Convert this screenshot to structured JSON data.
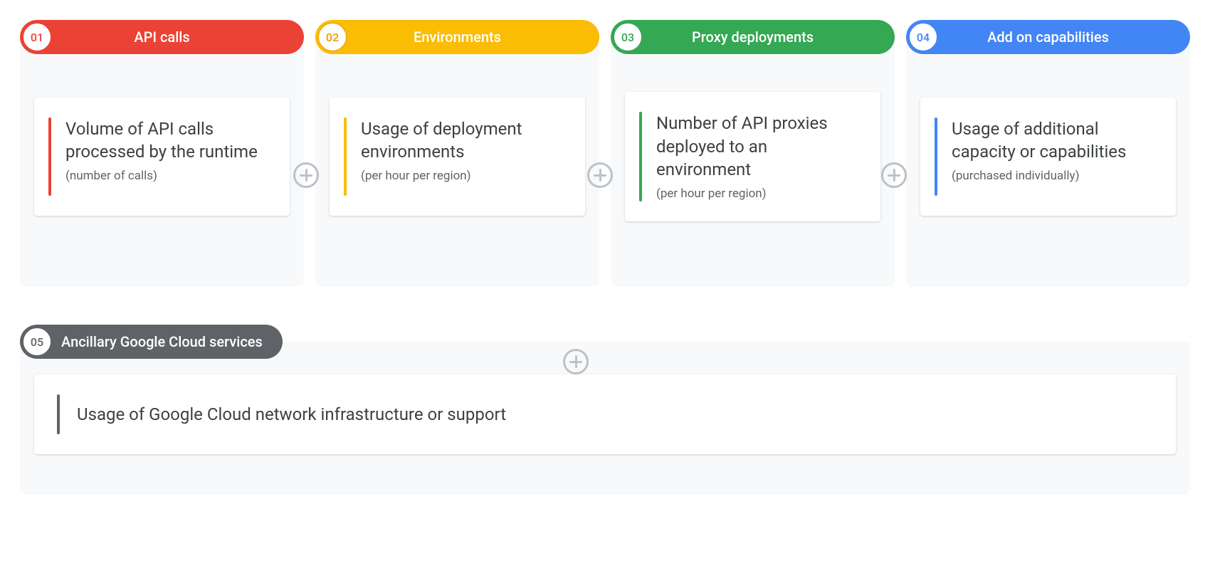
{
  "columns": [
    {
      "number": "01",
      "label": "API calls",
      "pillColor": "#ea4335",
      "numberColor": "#ea4335",
      "accentColor": "#ea4335",
      "title": "Volume of API calls processed by the runtime",
      "subtitle": "(number of calls)"
    },
    {
      "number": "02",
      "label": "Environments",
      "pillColor": "#fbbc04",
      "numberColor": "#f29900",
      "accentColor": "#fbbc04",
      "title": "Usage of deployment environments",
      "subtitle": "(per hour per region)"
    },
    {
      "number": "03",
      "label": "Proxy deployments",
      "pillColor": "#34a853",
      "numberColor": "#34a853",
      "accentColor": "#34a853",
      "title": "Number of API proxies deployed to an environment",
      "subtitle": "(per hour per region)"
    },
    {
      "number": "04",
      "label": "Add on capabilities",
      "pillColor": "#4285f4",
      "numberColor": "#4285f4",
      "accentColor": "#4285f4",
      "title": "Usage of additional capacity or capabilities",
      "subtitle": "(purchased individually)"
    }
  ],
  "bottom": {
    "number": "05",
    "label": "Ancillary Google Cloud services",
    "pillColor": "#5f6368",
    "numberColor": "#5f6368",
    "accentColor": "#5f6368",
    "title": "Usage of Google Cloud network infrastructure or support"
  }
}
